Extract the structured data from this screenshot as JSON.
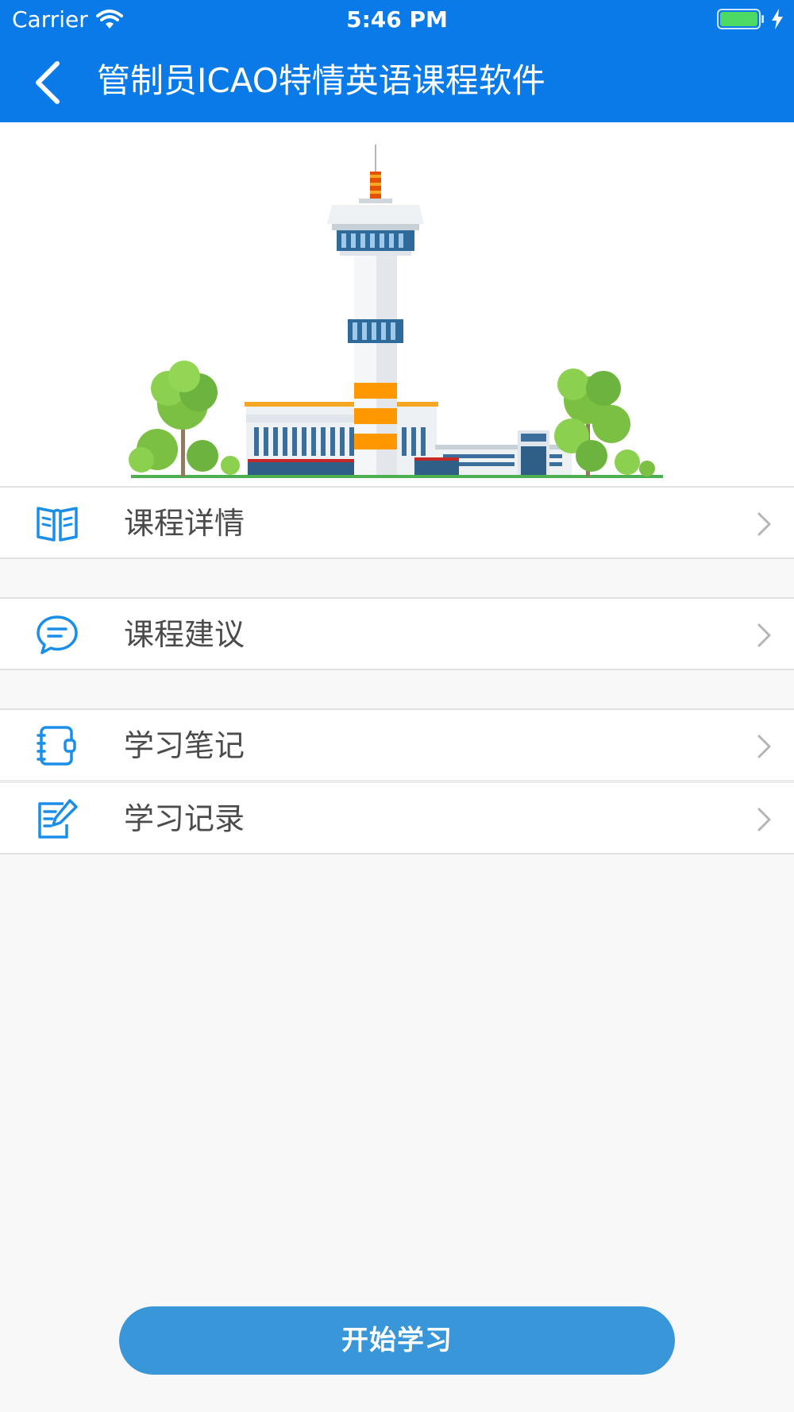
{
  "status_bar": {
    "carrier": "Carrier",
    "time": "5:46 PM",
    "wifi_icon": "wifi-icon",
    "battery_icon": "battery-icon",
    "charging_icon": "charging-bolt-icon"
  },
  "header": {
    "back_icon": "chevron-left-icon",
    "title": "管制员ICAO特情英语课程软件",
    "background_color": "#0a7ae8"
  },
  "hero": {
    "illustration": "air-traffic-control-tower-illustration"
  },
  "menu": {
    "groups": [
      [
        {
          "label": "课程详情",
          "icon": "open-book-icon"
        }
      ],
      [
        {
          "label": "课程建议",
          "icon": "chat-bubble-icon"
        }
      ],
      [
        {
          "label": "学习笔记",
          "icon": "notebook-icon"
        },
        {
          "label": "学习记录",
          "icon": "edit-document-icon"
        }
      ]
    ],
    "chevron_icon": "chevron-right-icon",
    "icon_color": "#1a8ee8"
  },
  "footer": {
    "start_button_label": "开始学习",
    "start_button_color": "#3996d9"
  }
}
